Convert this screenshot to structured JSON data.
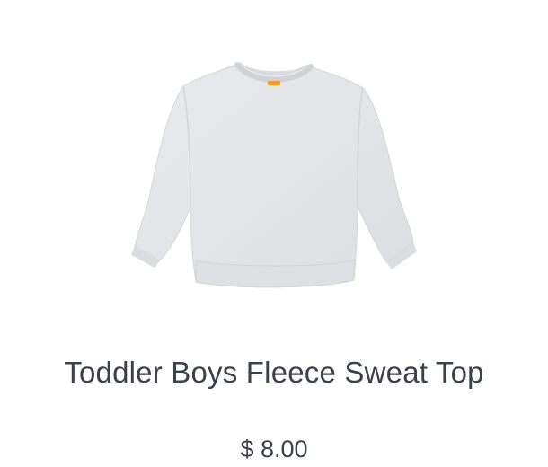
{
  "product": {
    "image_name": "grey-crewneck-sweatshirt",
    "title": "Toddler Boys Fleece Sweat Top",
    "price": "$ 8.00",
    "colors": {
      "fabric": "#e4e5e8",
      "fabric_shadow": "#d5d7db",
      "label_tag": "#f29a1b",
      "text": "#3b404b"
    }
  }
}
